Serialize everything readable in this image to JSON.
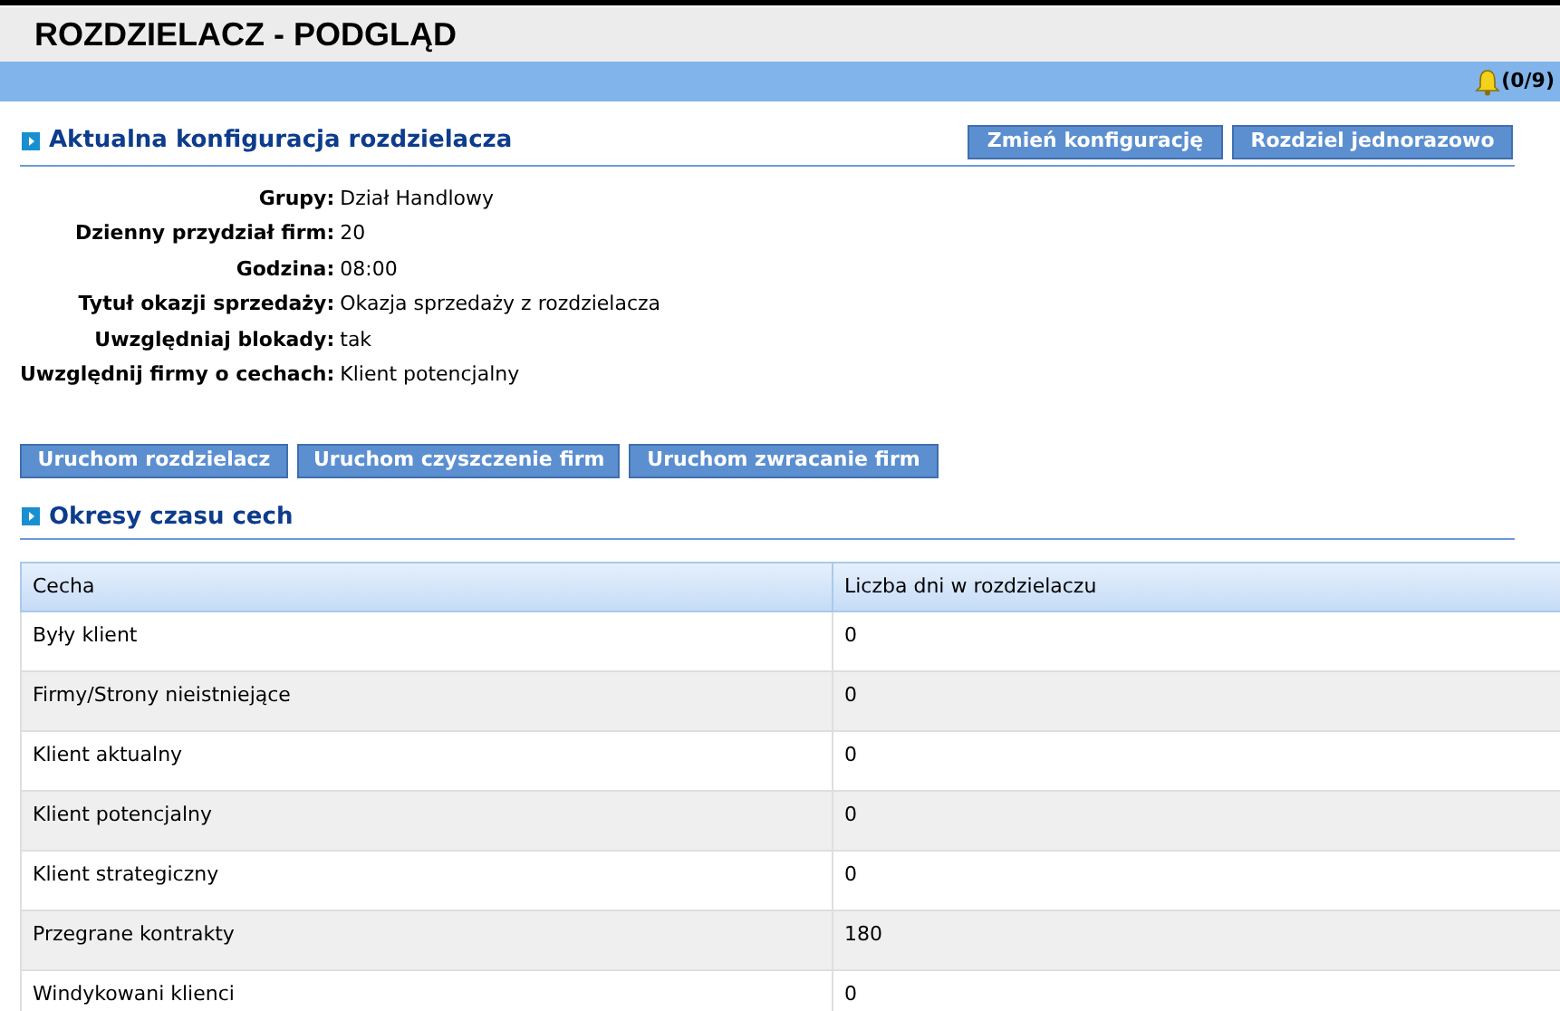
{
  "page": {
    "title": "ROZDZIELACZ - PODGLĄD"
  },
  "notifications": {
    "count": "(0/9)"
  },
  "config_section": {
    "heading": "Aktualna konfiguracja rozdzielacza",
    "buttons": [
      "Zmień konfigurację",
      "Rozdziel jednorazowo"
    ],
    "fields": [
      {
        "label": "Grupy:",
        "value": "Dział Handlowy"
      },
      {
        "label": "Dzienny przydział firm:",
        "value": "20"
      },
      {
        "label": "Godzina:",
        "value": "08:00"
      },
      {
        "label": "Tytuł okazji sprzedaży:",
        "value": "Okazja sprzedaży z rozdzielacza"
      },
      {
        "label": "Uwzględniaj blokady:",
        "value": "tak"
      },
      {
        "label": "Uwzględnij firmy o cechach:",
        "value": "Klient potencjalny"
      }
    ]
  },
  "action_buttons": [
    "Uruchom rozdzielacz",
    "Uruchom czyszczenie firm",
    "Uruchom zwracanie firm"
  ],
  "periods_section": {
    "heading": "Okresy czasu cech",
    "table": {
      "columns": [
        "Cecha",
        "Liczba dni w rozdzielaczu"
      ],
      "rows": [
        [
          "Były klient",
          "0"
        ],
        [
          "Firmy/Strony nieistniejące",
          "0"
        ],
        [
          "Klient aktualny",
          "0"
        ],
        [
          "Klient potencjalny",
          "0"
        ],
        [
          "Klient strategiczny",
          "0"
        ],
        [
          "Przegrane kontrakty",
          "180"
        ],
        [
          "Windykowani klienci",
          "0"
        ]
      ]
    }
  }
}
